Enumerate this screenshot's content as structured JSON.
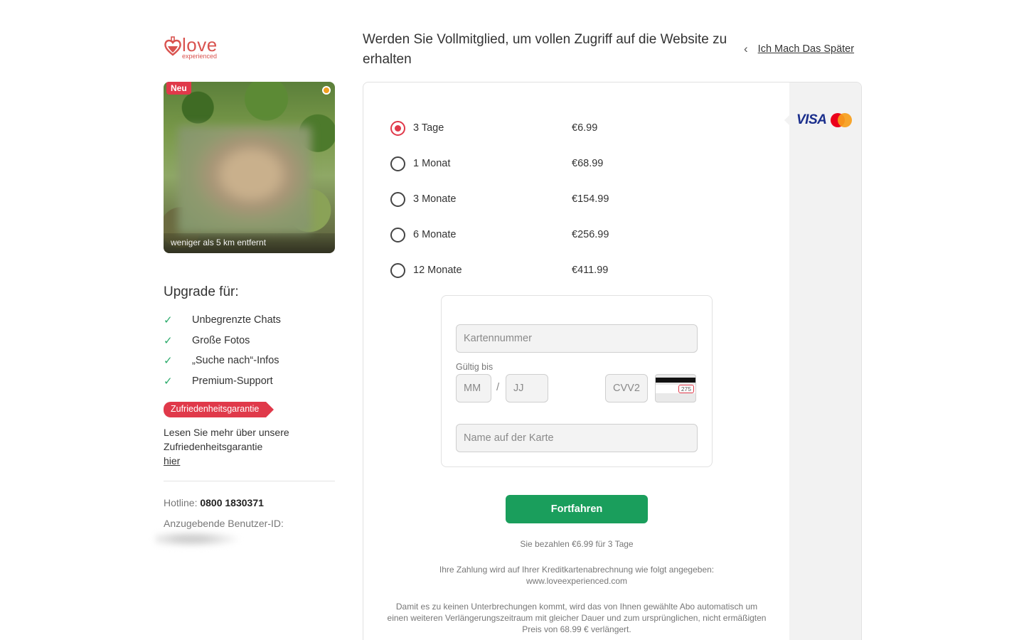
{
  "brand": {
    "name": "love",
    "tagline": "experienced",
    "color": "#d9534f"
  },
  "profile": {
    "badge": "Neu",
    "distance": "weniger als 5 km entfernt",
    "online_color": "#f0a020"
  },
  "upgrade": {
    "title": "Upgrade für:",
    "features": [
      "Unbegrenzte Chats",
      "Große Fotos",
      "„Suche nach“-Infos",
      "Premium-Support"
    ]
  },
  "guarantee": {
    "tag": "Zufriedenheitsgarantie",
    "text": "Lesen Sie mehr über unsere Zufriedenheitsgarantie",
    "link": "hier"
  },
  "contact": {
    "hotline_label": "Hotline:",
    "hotline_number": "0800 1830371",
    "userid_label": "Anzugebende Benutzer-ID:"
  },
  "header": {
    "title": "Werden Sie Vollmitglied, um vollen Zugriff auf die Website zu erhalten",
    "later_link": "Ich Mach Das Später"
  },
  "payment_brands": {
    "visa": "VISA",
    "mastercard": "mastercard-icon"
  },
  "plans": [
    {
      "name": "3 Tage",
      "price": "€6.99",
      "selected": true
    },
    {
      "name": "1 Monat",
      "price": "€68.99",
      "selected": false
    },
    {
      "name": "3 Monate",
      "price": "€154.99",
      "selected": false
    },
    {
      "name": "6 Monate",
      "price": "€256.99",
      "selected": false
    },
    {
      "name": "12 Monate",
      "price": "€411.99",
      "selected": false
    }
  ],
  "form": {
    "card_number_placeholder": "Kartennummer",
    "valid_label": "Gültig bis",
    "mm_placeholder": "MM",
    "slash": "/",
    "jj_placeholder": "JJ",
    "cvv_placeholder": "CVV2",
    "cvv_sample": "275",
    "name_placeholder": "Name auf der Karte"
  },
  "cta": {
    "label": "Fortfahren",
    "color": "#1a9e5c"
  },
  "notes": {
    "summary": "Sie bezahlen €6.99 für 3 Tage",
    "billing": "Ihre Zahlung wird auf Ihrer Kreditkartenabrechnung wie folgt angegeben:",
    "billing_url": "www.loveexperienced.com",
    "renewal": "Damit es zu keinen Unterbrechungen kommt, wird das von Ihnen gewählte Abo automatisch um einen weiteren Verlängerungszeitraum mit gleicher Dauer und zum ursprünglichen, nicht ermäßigten Preis von 68.99 € verlängert."
  },
  "accent_color": "#e0394a"
}
